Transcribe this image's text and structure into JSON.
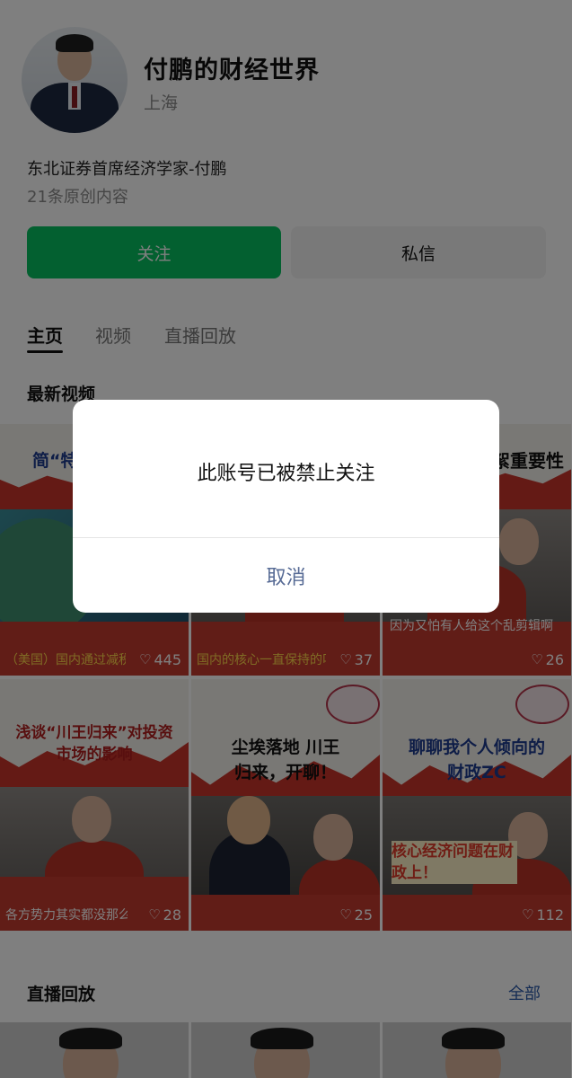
{
  "profile": {
    "name": "付鹏的财经世界",
    "location": "上海",
    "bio": "东北证券首席经济学家-付鹏",
    "content_count": "21条原创内容",
    "follow_label": "关注",
    "message_label": "私信",
    "accent_color": "#07c160"
  },
  "tabs": [
    {
      "label": "主页",
      "active": true
    },
    {
      "label": "视频",
      "active": false
    },
    {
      "label": "直播回放",
      "active": false
    }
  ],
  "latest_videos": {
    "title": "最新视频",
    "items": [
      {
        "headline": "简“特朗",
        "subline": "（美国）国内通过减税",
        "likes": "445"
      },
      {
        "headline": "",
        "subline": "国内的核心一直保持的叫国太经元",
        "likes": "37"
      },
      {
        "headline": "花絮重要性",
        "subline": "因为又怕有人给这个乱剪辑啊",
        "likes": "26"
      },
      {
        "headline": "浅谈“川王归来”对投资市场的影响",
        "subline": "各方势力其实都没那么的强硬",
        "likes": "28"
      },
      {
        "headline": "尘埃落地 川王归来，开聊！",
        "subline": "",
        "likes": "25"
      },
      {
        "headline": "聊聊我个人倾向的财政ZC",
        "subline": "核心经济问题在财政上！",
        "likes": "112"
      }
    ]
  },
  "replay": {
    "title": "直播回放",
    "all_label": "全部"
  },
  "dialog": {
    "message": "此账号已被禁止关注",
    "cancel_label": "取消",
    "cancel_color": "#576b95"
  }
}
